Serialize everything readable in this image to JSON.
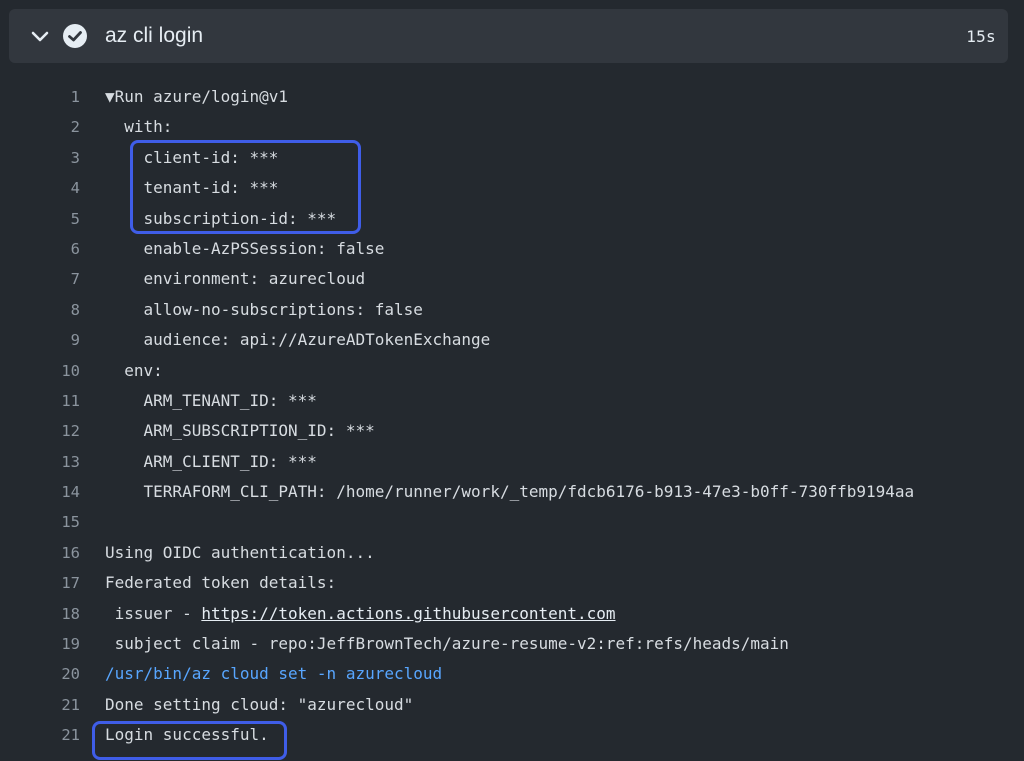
{
  "step": {
    "title": "az cli login",
    "duration": "15s",
    "status": "success"
  },
  "log": {
    "lines": [
      {
        "num": "1",
        "text": "▼Run azure/login@v1"
      },
      {
        "num": "2",
        "text": "  with:"
      },
      {
        "num": "3",
        "text": "    client-id: ***"
      },
      {
        "num": "4",
        "text": "    tenant-id: ***"
      },
      {
        "num": "5",
        "text": "    subscription-id: ***"
      },
      {
        "num": "6",
        "text": "    enable-AzPSSession: false"
      },
      {
        "num": "7",
        "text": "    environment: azurecloud"
      },
      {
        "num": "8",
        "text": "    allow-no-subscriptions: false"
      },
      {
        "num": "9",
        "text": "    audience: api://AzureADTokenExchange"
      },
      {
        "num": "10",
        "text": "  env:"
      },
      {
        "num": "11",
        "text": "    ARM_TENANT_ID: ***"
      },
      {
        "num": "12",
        "text": "    ARM_SUBSCRIPTION_ID: ***"
      },
      {
        "num": "13",
        "text": "    ARM_CLIENT_ID: ***"
      },
      {
        "num": "14",
        "text": "    TERRAFORM_CLI_PATH: /home/runner/work/_temp/fdcb6176-b913-47e3-b0ff-730ffb9194aa"
      },
      {
        "num": "15",
        "text": ""
      },
      {
        "num": "16",
        "text": "Using OIDC authentication..."
      },
      {
        "num": "17",
        "text": "Federated token details:"
      },
      {
        "num": "18",
        "text": " issuer - ",
        "link": "https://token.actions.githubusercontent.com"
      },
      {
        "num": "19",
        "text": " subject claim - repo:JeffBrownTech/azure-resume-v2:ref:refs/heads/main"
      },
      {
        "num": "20",
        "text": "/usr/bin/az cloud set -n azurecloud",
        "kind": "command"
      },
      {
        "num": "21",
        "text": "Done setting cloud: \"azurecloud\""
      },
      {
        "num": "21",
        "text": "Login successful."
      }
    ]
  },
  "colors": {
    "background": "#24292f",
    "header": "#32373e",
    "command": "#58a6ff",
    "highlight_box": "#3f5de8"
  }
}
